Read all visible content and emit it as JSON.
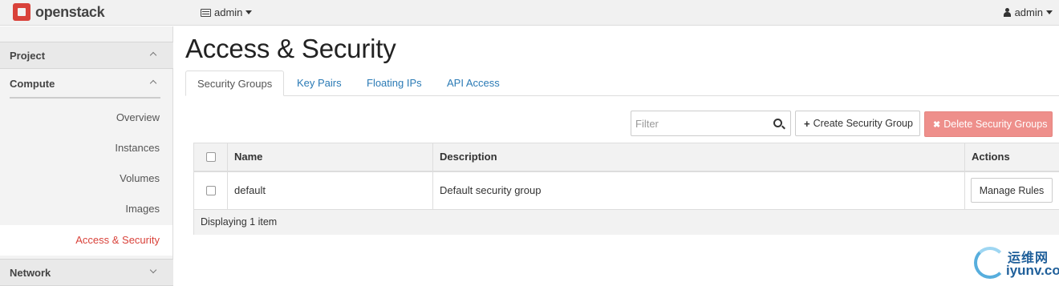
{
  "navbar": {
    "logo": "openstack",
    "project_selector": "admin",
    "user_menu": "admin"
  },
  "sidebar": {
    "section": "Project",
    "group": "Compute",
    "items": [
      {
        "label": "Overview"
      },
      {
        "label": "Instances"
      },
      {
        "label": "Volumes"
      },
      {
        "label": "Images"
      },
      {
        "label": "Access & Security",
        "active": true
      }
    ],
    "next_group": "Network"
  },
  "main": {
    "title": "Access & Security",
    "tabs": [
      "Security Groups",
      "Key Pairs",
      "Floating IPs",
      "API Access"
    ],
    "active_tab": "Security Groups",
    "filter_placeholder": "Filter",
    "create_button": "Create Security Group",
    "delete_button": "Delete Security Groups"
  },
  "table": {
    "columns": [
      "Name",
      "Description",
      "Actions"
    ],
    "rows": [
      {
        "name": "default",
        "description": "Default security group",
        "action": "Manage Rules"
      }
    ],
    "footer": "Displaying 1 item"
  },
  "watermark": {
    "cn": "运维网",
    "en": "iyunv.com"
  },
  "colors": {
    "accent": "#d9423a",
    "link": "#2a7ab5",
    "danger_disabled": "#ee8f8b"
  }
}
